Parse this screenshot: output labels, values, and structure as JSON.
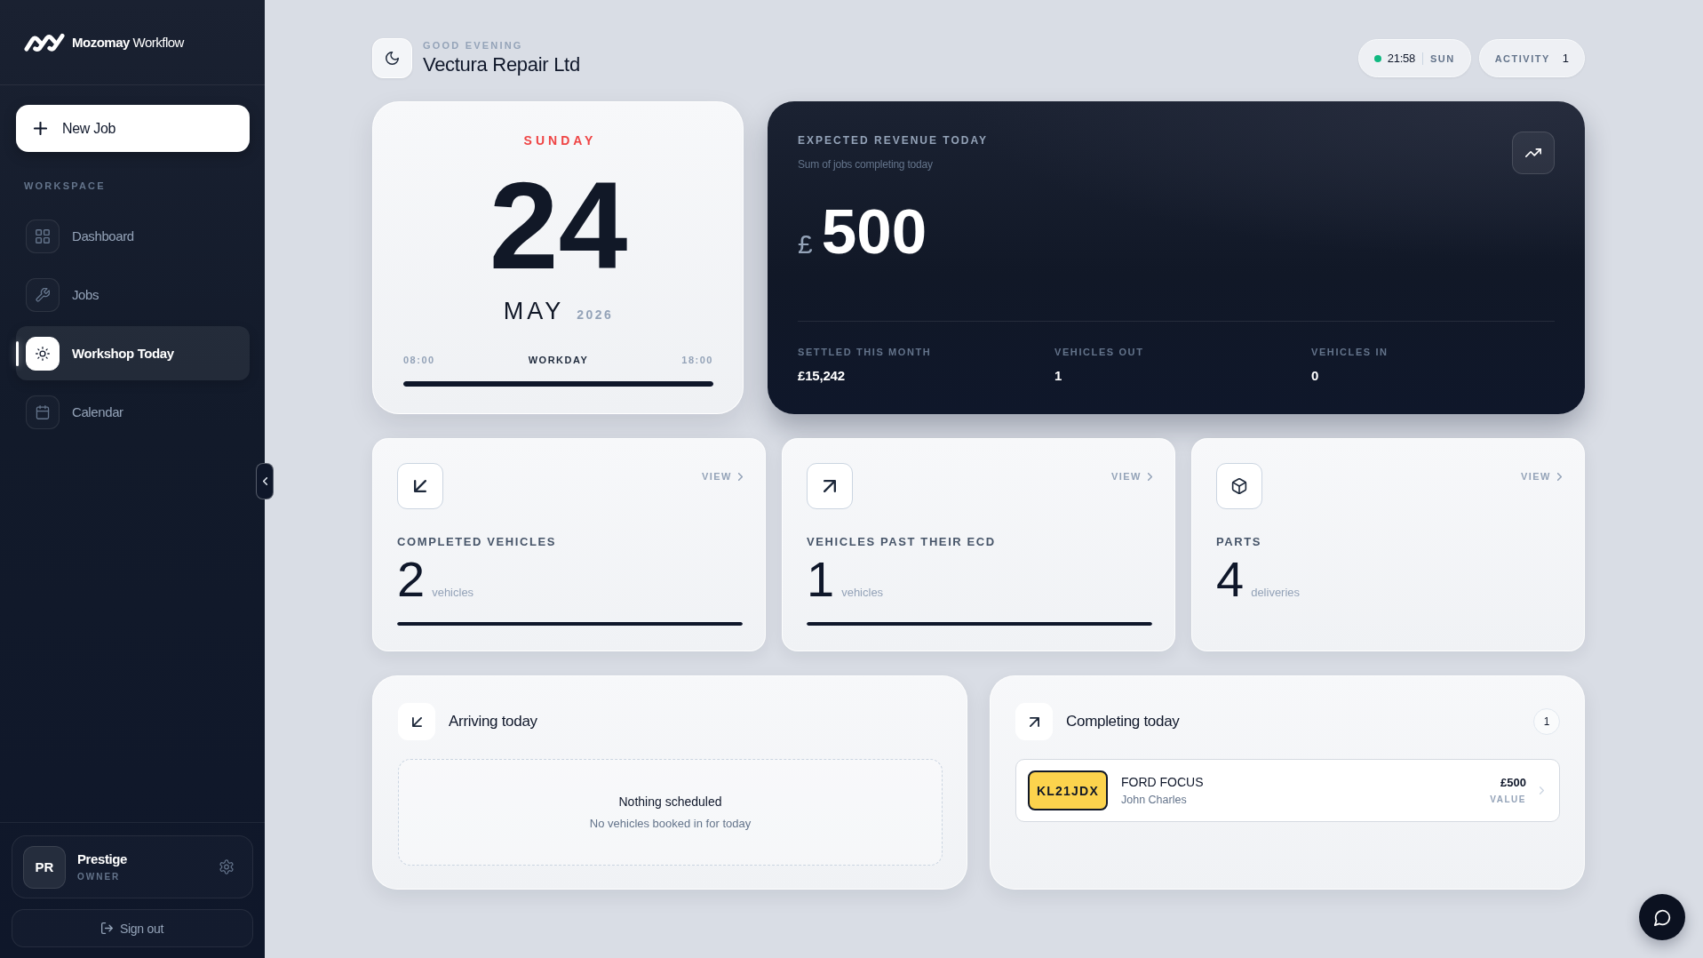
{
  "sidebar": {
    "logo_text": "**Mozomay** Workflow",
    "new_job_button": "New Job",
    "section_label": "WORKSPACE",
    "items": [
      {
        "label": "Dashboard",
        "selected": false
      },
      {
        "label": "Jobs",
        "selected": false
      },
      {
        "label": "Workshop Today",
        "selected": true
      },
      {
        "label": "Calendar",
        "selected": false
      }
    ],
    "profile": {
      "initials": "PR",
      "name": "Prestige",
      "role": "OWNER"
    },
    "sign_out_button": "Sign out"
  },
  "header": {
    "greeting": "GOOD EVENING",
    "company": "Vectura Repair Ltd",
    "clock": {
      "live": true,
      "time": "21:58",
      "day": "SUN"
    },
    "activity": {
      "label": "ACTIVITY",
      "count": "1"
    }
  },
  "date_card": {
    "weekday": "SUNDAY",
    "day": "24",
    "month": "MAY",
    "year": "2026",
    "workday": {
      "start": "08:00",
      "label": "WORKDAY",
      "end": "18:00",
      "level": 1
    }
  },
  "revenue_card": {
    "title": "EXPECTED REVENUE TODAY",
    "subtitle": "Sum of jobs completing today",
    "currency": "£",
    "amount": "500",
    "stats": [
      {
        "label": "SETTLED THIS MONTH",
        "value": "£15,242"
      },
      {
        "label": "VEHICLES OUT",
        "value": "1"
      },
      {
        "label": "VEHICLES IN",
        "value": "0"
      }
    ]
  },
  "stat_cards": [
    {
      "label": "COMPLETED VEHICLES",
      "value": "2",
      "unit": "vehicles",
      "link": "VIEW",
      "level": 1
    },
    {
      "label": "VEHICLES PAST THEIR ECD",
      "value": "1",
      "unit": "vehicles",
      "link": "VIEW",
      "level": 1
    },
    {
      "label": "PARTS",
      "value": "4",
      "unit": "deliveries",
      "link": "VIEW"
    }
  ],
  "arriving_today": {
    "title": "Arriving today",
    "empty_title": "Nothing scheduled",
    "empty_message": "No vehicles booked in for today"
  },
  "completing_today": {
    "title": "Completing today",
    "count": "1",
    "jobs": [
      {
        "plate": "KL21JDX",
        "vehicle": "FORD FOCUS",
        "customer": "John Charles",
        "value": "£500",
        "value_label": "VALUE"
      }
    ]
  }
}
